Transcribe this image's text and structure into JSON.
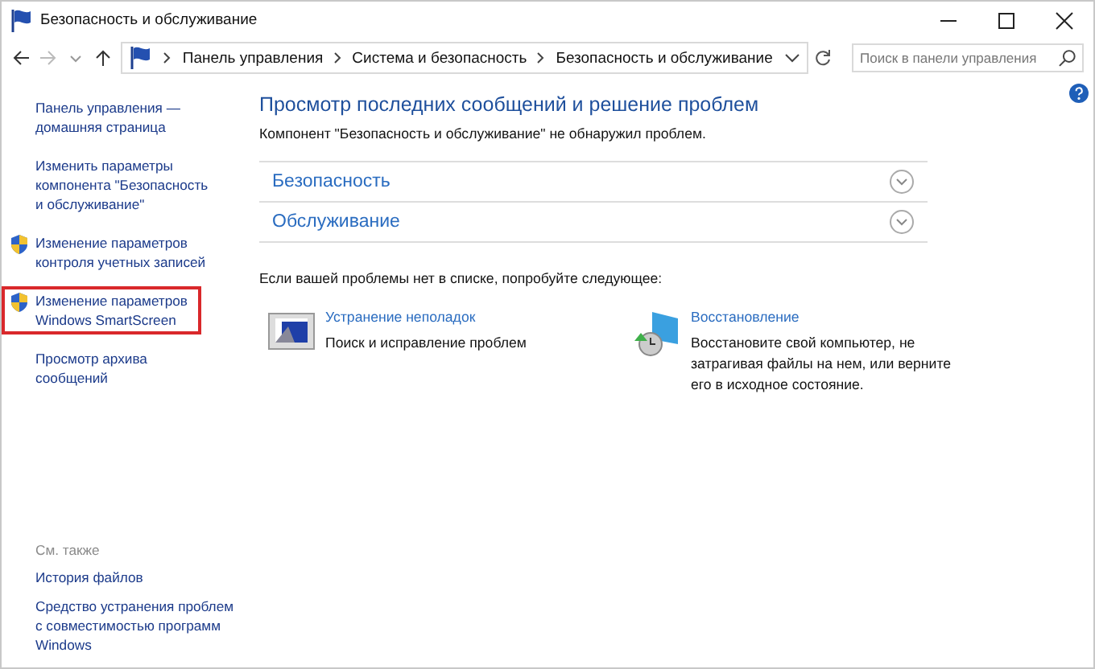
{
  "window": {
    "title": "Безопасность и обслуживание"
  },
  "address_bar": {
    "breadcrumbs": [
      "Панель управления",
      "Система и безопасность",
      "Безопасность и обслуживание"
    ],
    "search": {
      "placeholder": "Поиск в панели управления"
    }
  },
  "sidebar": {
    "items": [
      {
        "label": "Панель управления — домашняя страница",
        "shield": false,
        "highlighted": false
      },
      {
        "label": "Изменить параметры компонента \"Безопасность и обслуживание\"",
        "shield": false,
        "highlighted": false
      },
      {
        "label": "Изменение параметров контроля учетных записей",
        "shield": true,
        "highlighted": false
      },
      {
        "label": "Изменение параметров Windows SmartScreen",
        "shield": true,
        "highlighted": true
      },
      {
        "label": "Просмотр архива сообщений",
        "shield": false,
        "highlighted": false
      }
    ],
    "see_also": {
      "heading": "См. также",
      "links": [
        "История файлов",
        "Средство устранения проблем с совместимостью программ Windows"
      ]
    }
  },
  "main": {
    "heading": "Просмотр последних сообщений и решение проблем",
    "status": "Компонент \"Безопасность и обслуживание\" не обнаружил проблем.",
    "sections": [
      {
        "label": "Безопасность",
        "expanded": false
      },
      {
        "label": "Обслуживание",
        "expanded": false
      }
    ],
    "suggestion": "Если вашей проблемы нет в списке, попробуйте следующее:",
    "tools": [
      {
        "kind": "troubleshoot",
        "title": "Устранение неполадок",
        "description": "Поиск и исправление проблем"
      },
      {
        "kind": "recovery",
        "title": "Восстановление",
        "description": "Восстановите свой компьютер, не затрагивая файлы на нем, или верните его в исходное состояние."
      }
    ]
  }
}
